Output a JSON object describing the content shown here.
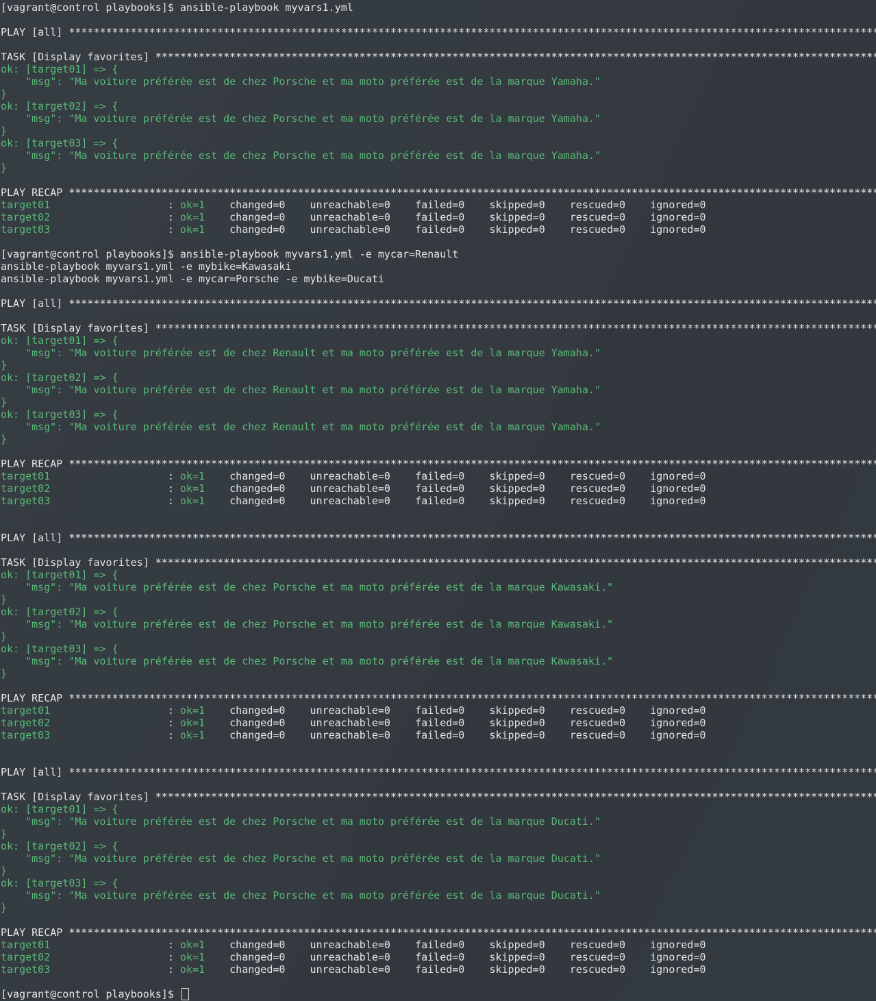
{
  "terminal": {
    "lines": [
      {
        "segments": [
          {
            "text": "[vagrant@control playbooks]$ ansible-playbook myvars1.yml",
            "cls": "prompt"
          }
        ]
      },
      {
        "segments": []
      },
      {
        "segments": [
          {
            "text": "PLAY [all] ****************************************************************************************************************************************************",
            "cls": "plain"
          }
        ]
      },
      {
        "segments": []
      },
      {
        "segments": [
          {
            "text": "TASK [Display favorites] **************************************************************************************************************************************",
            "cls": "plain"
          }
        ]
      },
      {
        "segments": [
          {
            "text": "ok: [target01] => {",
            "cls": "ok"
          }
        ]
      },
      {
        "segments": [
          {
            "text": "    \"msg\": \"Ma voiture préférée est de chez Porsche et ma moto préférée est de la marque Yamaha.\"",
            "cls": "ok"
          }
        ]
      },
      {
        "segments": [
          {
            "text": "}",
            "cls": "ok"
          }
        ]
      },
      {
        "segments": [
          {
            "text": "ok: [target02] => {",
            "cls": "ok"
          }
        ]
      },
      {
        "segments": [
          {
            "text": "    \"msg\": \"Ma voiture préférée est de chez Porsche et ma moto préférée est de la marque Yamaha.\"",
            "cls": "ok"
          }
        ]
      },
      {
        "segments": [
          {
            "text": "}",
            "cls": "ok"
          }
        ]
      },
      {
        "segments": [
          {
            "text": "ok: [target03] => {",
            "cls": "ok"
          }
        ]
      },
      {
        "segments": [
          {
            "text": "    \"msg\": \"Ma voiture préférée est de chez Porsche et ma moto préférée est de la marque Yamaha.\"",
            "cls": "ok"
          }
        ]
      },
      {
        "segments": [
          {
            "text": "}",
            "cls": "ok"
          }
        ]
      },
      {
        "segments": []
      },
      {
        "segments": [
          {
            "text": "PLAY RECAP ****************************************************************************************************************************************************",
            "cls": "plain"
          }
        ]
      },
      {
        "segments": [
          {
            "text": "target01",
            "cls": "green"
          },
          {
            "text": "                   : ",
            "cls": "plain"
          },
          {
            "text": "ok=1",
            "cls": "green"
          },
          {
            "text": "    changed=0    unreachable=0    failed=0    skipped=0    rescued=0    ignored=0",
            "cls": "plain"
          }
        ]
      },
      {
        "segments": [
          {
            "text": "target02",
            "cls": "green"
          },
          {
            "text": "                   : ",
            "cls": "plain"
          },
          {
            "text": "ok=1",
            "cls": "green"
          },
          {
            "text": "    changed=0    unreachable=0    failed=0    skipped=0    rescued=0    ignored=0",
            "cls": "plain"
          }
        ]
      },
      {
        "segments": [
          {
            "text": "target03",
            "cls": "green"
          },
          {
            "text": "                   : ",
            "cls": "plain"
          },
          {
            "text": "ok=1",
            "cls": "green"
          },
          {
            "text": "    changed=0    unreachable=0    failed=0    skipped=0    rescued=0    ignored=0",
            "cls": "plain"
          }
        ]
      },
      {
        "segments": []
      },
      {
        "segments": [
          {
            "text": "[vagrant@control playbooks]$ ansible-playbook myvars1.yml -e mycar=Renault",
            "cls": "prompt"
          }
        ]
      },
      {
        "segments": [
          {
            "text": "ansible-playbook myvars1.yml -e mybike=Kawasaki",
            "cls": "plain"
          }
        ]
      },
      {
        "segments": [
          {
            "text": "ansible-playbook myvars1.yml -e mycar=Porsche -e mybike=Ducati",
            "cls": "plain"
          }
        ]
      },
      {
        "segments": []
      },
      {
        "segments": [
          {
            "text": "PLAY [all] ****************************************************************************************************************************************************",
            "cls": "plain"
          }
        ]
      },
      {
        "segments": []
      },
      {
        "segments": [
          {
            "text": "TASK [Display favorites] **************************************************************************************************************************************",
            "cls": "plain"
          }
        ]
      },
      {
        "segments": [
          {
            "text": "ok: [target01] => {",
            "cls": "ok"
          }
        ]
      },
      {
        "segments": [
          {
            "text": "    \"msg\": \"Ma voiture préférée est de chez Renault et ma moto préférée est de la marque Yamaha.\"",
            "cls": "ok"
          }
        ]
      },
      {
        "segments": [
          {
            "text": "}",
            "cls": "ok"
          }
        ]
      },
      {
        "segments": [
          {
            "text": "ok: [target02] => {",
            "cls": "ok"
          }
        ]
      },
      {
        "segments": [
          {
            "text": "    \"msg\": \"Ma voiture préférée est de chez Renault et ma moto préférée est de la marque Yamaha.\"",
            "cls": "ok"
          }
        ]
      },
      {
        "segments": [
          {
            "text": "}",
            "cls": "ok"
          }
        ]
      },
      {
        "segments": [
          {
            "text": "ok: [target03] => {",
            "cls": "ok"
          }
        ]
      },
      {
        "segments": [
          {
            "text": "    \"msg\": \"Ma voiture préférée est de chez Renault et ma moto préférée est de la marque Yamaha.\"",
            "cls": "ok"
          }
        ]
      },
      {
        "segments": [
          {
            "text": "}",
            "cls": "ok"
          }
        ]
      },
      {
        "segments": []
      },
      {
        "segments": [
          {
            "text": "PLAY RECAP ****************************************************************************************************************************************************",
            "cls": "plain"
          }
        ]
      },
      {
        "segments": [
          {
            "text": "target01",
            "cls": "green"
          },
          {
            "text": "                   : ",
            "cls": "plain"
          },
          {
            "text": "ok=1",
            "cls": "green"
          },
          {
            "text": "    changed=0    unreachable=0    failed=0    skipped=0    rescued=0    ignored=0",
            "cls": "plain"
          }
        ]
      },
      {
        "segments": [
          {
            "text": "target02",
            "cls": "green"
          },
          {
            "text": "                   : ",
            "cls": "plain"
          },
          {
            "text": "ok=1",
            "cls": "green"
          },
          {
            "text": "    changed=0    unreachable=0    failed=0    skipped=0    rescued=0    ignored=0",
            "cls": "plain"
          }
        ]
      },
      {
        "segments": [
          {
            "text": "target03",
            "cls": "green"
          },
          {
            "text": "                   : ",
            "cls": "plain"
          },
          {
            "text": "ok=1",
            "cls": "green"
          },
          {
            "text": "    changed=0    unreachable=0    failed=0    skipped=0    rescued=0    ignored=0",
            "cls": "plain"
          }
        ]
      },
      {
        "segments": []
      },
      {
        "segments": []
      },
      {
        "segments": [
          {
            "text": "PLAY [all] ****************************************************************************************************************************************************",
            "cls": "plain"
          }
        ]
      },
      {
        "segments": []
      },
      {
        "segments": [
          {
            "text": "TASK [Display favorites] **************************************************************************************************************************************",
            "cls": "plain"
          }
        ]
      },
      {
        "segments": [
          {
            "text": "ok: [target01] => {",
            "cls": "ok"
          }
        ]
      },
      {
        "segments": [
          {
            "text": "    \"msg\": \"Ma voiture préférée est de chez Porsche et ma moto préférée est de la marque Kawasaki.\"",
            "cls": "ok"
          }
        ]
      },
      {
        "segments": [
          {
            "text": "}",
            "cls": "ok"
          }
        ]
      },
      {
        "segments": [
          {
            "text": "ok: [target02] => {",
            "cls": "ok"
          }
        ]
      },
      {
        "segments": [
          {
            "text": "    \"msg\": \"Ma voiture préférée est de chez Porsche et ma moto préférée est de la marque Kawasaki.\"",
            "cls": "ok"
          }
        ]
      },
      {
        "segments": [
          {
            "text": "}",
            "cls": "ok"
          }
        ]
      },
      {
        "segments": [
          {
            "text": "ok: [target03] => {",
            "cls": "ok"
          }
        ]
      },
      {
        "segments": [
          {
            "text": "    \"msg\": \"Ma voiture préférée est de chez Porsche et ma moto préférée est de la marque Kawasaki.\"",
            "cls": "ok"
          }
        ]
      },
      {
        "segments": [
          {
            "text": "}",
            "cls": "ok"
          }
        ]
      },
      {
        "segments": []
      },
      {
        "segments": [
          {
            "text": "PLAY RECAP ****************************************************************************************************************************************************",
            "cls": "plain"
          }
        ]
      },
      {
        "segments": [
          {
            "text": "target01",
            "cls": "green"
          },
          {
            "text": "                   : ",
            "cls": "plain"
          },
          {
            "text": "ok=1",
            "cls": "green"
          },
          {
            "text": "    changed=0    unreachable=0    failed=0    skipped=0    rescued=0    ignored=0",
            "cls": "plain"
          }
        ]
      },
      {
        "segments": [
          {
            "text": "target02",
            "cls": "green"
          },
          {
            "text": "                   : ",
            "cls": "plain"
          },
          {
            "text": "ok=1",
            "cls": "green"
          },
          {
            "text": "    changed=0    unreachable=0    failed=0    skipped=0    rescued=0    ignored=0",
            "cls": "plain"
          }
        ]
      },
      {
        "segments": [
          {
            "text": "target03",
            "cls": "green"
          },
          {
            "text": "                   : ",
            "cls": "plain"
          },
          {
            "text": "ok=1",
            "cls": "green"
          },
          {
            "text": "    changed=0    unreachable=0    failed=0    skipped=0    rescued=0    ignored=0",
            "cls": "plain"
          }
        ]
      },
      {
        "segments": []
      },
      {
        "segments": []
      },
      {
        "segments": [
          {
            "text": "PLAY [all] ****************************************************************************************************************************************************",
            "cls": "plain"
          }
        ]
      },
      {
        "segments": []
      },
      {
        "segments": [
          {
            "text": "TASK [Display favorites] **************************************************************************************************************************************",
            "cls": "plain"
          }
        ]
      },
      {
        "segments": [
          {
            "text": "ok: [target01] => {",
            "cls": "ok"
          }
        ]
      },
      {
        "segments": [
          {
            "text": "    \"msg\": \"Ma voiture préférée est de chez Porsche et ma moto préférée est de la marque Ducati.\"",
            "cls": "ok"
          }
        ]
      },
      {
        "segments": [
          {
            "text": "}",
            "cls": "ok"
          }
        ]
      },
      {
        "segments": [
          {
            "text": "ok: [target02] => {",
            "cls": "ok"
          }
        ]
      },
      {
        "segments": [
          {
            "text": "    \"msg\": \"Ma voiture préférée est de chez Porsche et ma moto préférée est de la marque Ducati.\"",
            "cls": "ok"
          }
        ]
      },
      {
        "segments": [
          {
            "text": "}",
            "cls": "ok"
          }
        ]
      },
      {
        "segments": [
          {
            "text": "ok: [target03] => {",
            "cls": "ok"
          }
        ]
      },
      {
        "segments": [
          {
            "text": "    \"msg\": \"Ma voiture préférée est de chez Porsche et ma moto préférée est de la marque Ducati.\"",
            "cls": "ok"
          }
        ]
      },
      {
        "segments": [
          {
            "text": "}",
            "cls": "ok"
          }
        ]
      },
      {
        "segments": []
      },
      {
        "segments": [
          {
            "text": "PLAY RECAP ****************************************************************************************************************************************************",
            "cls": "plain"
          }
        ]
      },
      {
        "segments": [
          {
            "text": "target01",
            "cls": "green"
          },
          {
            "text": "                   : ",
            "cls": "plain"
          },
          {
            "text": "ok=1",
            "cls": "green"
          },
          {
            "text": "    changed=0    unreachable=0    failed=0    skipped=0    rescued=0    ignored=0",
            "cls": "plain"
          }
        ]
      },
      {
        "segments": [
          {
            "text": "target02",
            "cls": "green"
          },
          {
            "text": "                   : ",
            "cls": "plain"
          },
          {
            "text": "ok=1",
            "cls": "green"
          },
          {
            "text": "    changed=0    unreachable=0    failed=0    skipped=0    rescued=0    ignored=0",
            "cls": "plain"
          }
        ]
      },
      {
        "segments": [
          {
            "text": "target03",
            "cls": "green"
          },
          {
            "text": "                   : ",
            "cls": "plain"
          },
          {
            "text": "ok=1",
            "cls": "green"
          },
          {
            "text": "    changed=0    unreachable=0    failed=0    skipped=0    rescued=0    ignored=0",
            "cls": "plain"
          }
        ]
      },
      {
        "segments": []
      },
      {
        "segments": [
          {
            "text": "[vagrant@control playbooks]$ ",
            "cls": "prompt"
          }
        ],
        "cursor": true
      }
    ]
  },
  "colors": {
    "background": "#343b41",
    "text": "#e6e6e6",
    "ok_green": "#5bb878"
  }
}
